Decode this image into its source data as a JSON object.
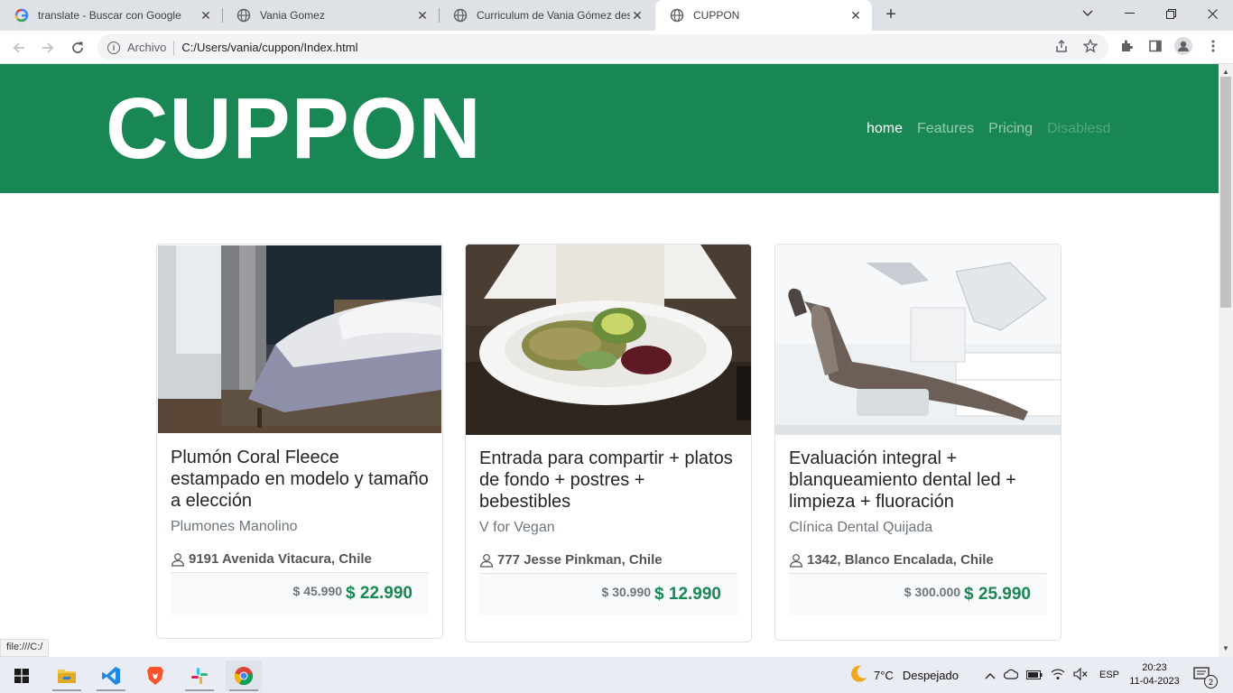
{
  "browser": {
    "tabs": [
      {
        "title": "translate - Buscar con Google",
        "icon": "google-icon"
      },
      {
        "title": "Vania Gomez",
        "icon": "globe-icon"
      },
      {
        "title": "Curriculum de Vania Gómez desa",
        "icon": "globe-icon"
      },
      {
        "title": "CUPPON",
        "icon": "globe-icon",
        "active": true
      }
    ],
    "address": {
      "scheme_label": "Archivo",
      "url": "C:/Users/vania/cuppon/Index.html"
    },
    "status_link": "file:///C:/"
  },
  "page": {
    "brand": "CUPPON",
    "nav": [
      {
        "label": "home",
        "state": "active"
      },
      {
        "label": "Features",
        "state": "normal"
      },
      {
        "label": "Pricing",
        "state": "normal"
      },
      {
        "label": "Disablesd",
        "state": "disabled"
      }
    ],
    "accent_color": "#198754",
    "cards": [
      {
        "title": "Plumón Coral Fleece estampado en modelo y tamaño a elección",
        "merchant": "Plumones Manolino",
        "address": "9191 Avenida Vitacura, Chile",
        "old_price": "$ 45.990",
        "new_price": "$ 22.990",
        "image": "bedroom-photo"
      },
      {
        "title": "Entrada para compartir + platos de fondo + postres + bebestibles",
        "merchant": "V for Vegan",
        "address": "777 Jesse Pinkman, Chile",
        "old_price": "$ 30.990",
        "new_price": "$ 12.990",
        "image": "salad-plate-photo"
      },
      {
        "title": "Evaluación integral + blanqueamiento dental led + limpieza + fluoración",
        "merchant": "Clínica Dental Quijada",
        "address": "1342, Blanco Encalada, Chile",
        "old_price": "$ 300.000",
        "new_price": "$ 25.990",
        "image": "dental-chair-photo"
      }
    ]
  },
  "taskbar": {
    "weather_temp": "7°C",
    "weather_text": "Despejado",
    "lang": "ESP",
    "time": "20:23",
    "date": "11-04-2023",
    "notifications": "2"
  }
}
